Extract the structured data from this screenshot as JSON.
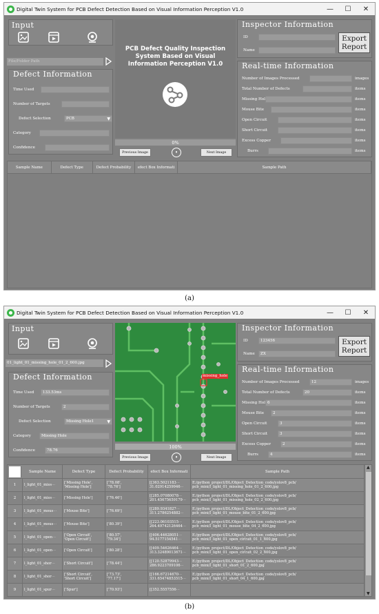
{
  "captions": [
    "(a)",
    "(b)"
  ],
  "colors": {
    "window_bg": "#808080",
    "panel_bg": "#878787",
    "field_bg": "#9a9a9a",
    "pcb_green": "#2e8b3e",
    "app_icon": "#3bb54a"
  },
  "window_a": {
    "title": "Digital Twin System for PCB Defect Detection Based on Visual Information Perception V1.0",
    "controls": {
      "min": "—",
      "max": "☐",
      "close": "✕"
    },
    "input": {
      "title": "Input",
      "icons": [
        "image-icon",
        "video-icon",
        "camera-icon"
      ],
      "path_placeholder": "File/Folder Path"
    },
    "defect_info": {
      "title": "Defect Information",
      "time_used_label": "Time Used",
      "time_used_value": "",
      "targets_label": "Number of Targets",
      "targets_value": "",
      "selection_label": "Defect Selection",
      "selection_value": "PCB",
      "category_label": "Category",
      "category_value": "",
      "confidence_label": "Confidence",
      "confidence_value": ""
    },
    "center": {
      "title_line1": "PCB Defect Quality Inspection",
      "title_line2": "System Based on Visual",
      "title_line3": "Information Perception V1.0",
      "progress_text": "0%",
      "progress": 0.0
    },
    "buttons": {
      "prev": "Previous Image",
      "pause": "⏸",
      "next": "Next Image"
    },
    "inspector": {
      "title": "Inspector Information",
      "id_label": "ID",
      "id_value": "",
      "name_label": "Name",
      "name_value": "",
      "export_l1": "Export",
      "export_l2": "Report"
    },
    "realtime": {
      "title": "Real-time Information",
      "rows": [
        {
          "label": "Number of Images Processed",
          "value": "",
          "unit": "images"
        },
        {
          "label": "Total Number of Defects",
          "value": "",
          "unit": "items"
        },
        {
          "label": "Missing Hole",
          "value": "",
          "unit": "items"
        },
        {
          "label": "Mouse Bite",
          "value": "",
          "unit": "items"
        },
        {
          "label": "Open Circuit",
          "value": "",
          "unit": "items"
        },
        {
          "label": "Short Circuit",
          "value": "",
          "unit": "items"
        },
        {
          "label": "Excess Copper",
          "value": "",
          "unit": "items"
        },
        {
          "label": "Burrs",
          "value": "",
          "unit": "items"
        }
      ]
    },
    "table": {
      "headers": [
        "Sample Name",
        "Defect Type",
        "Defect Probability",
        "efect Box Informati",
        "Sample Path"
      ]
    }
  },
  "window_b": {
    "title": "Digital Twin System for PCB Defect Detection Based on Visual Information Perception V1.0",
    "controls": {
      "min": "—",
      "max": "☐",
      "close": "✕"
    },
    "input": {
      "title": "Input",
      "icons": [
        "image-icon",
        "video-icon",
        "camera-icon"
      ],
      "path_value": "01_light_01_missing_hole_01_2_600.jpg"
    },
    "defect_info": {
      "title": "Defect Information",
      "time_used_label": "Time Used",
      "time_used_value": "133.53ms",
      "targets_label": "Number of Targets",
      "targets_value": "2",
      "selection_label": "Defect Selection",
      "selection_value": "Missing Hole1",
      "category_label": "Category",
      "category_value": "Missing Hole",
      "confidence_label": "Confidence",
      "confidence_value": "78.76"
    },
    "center": {
      "detection_label": "missing_hole",
      "progress_text": "100%",
      "progress": 1.0
    },
    "buttons": {
      "prev": "Previous Image",
      "pause": "⏸",
      "next": "Next Image"
    },
    "inspector": {
      "title": "Inspector Information",
      "id_label": "ID",
      "id_value": "123456",
      "name_label": "Name",
      "name_value": "ZX",
      "export_l1": "Export",
      "export_l2": "Report"
    },
    "realtime": {
      "title": "Real-time Information",
      "rows": [
        {
          "label": "Number of Images Processed",
          "value": "12",
          "unit": "images"
        },
        {
          "label": "Total Number of Defects",
          "value": "20",
          "unit": "items"
        },
        {
          "label": "Missing Hole",
          "value": "6",
          "unit": "items"
        },
        {
          "label": "Mouse Bite",
          "value": "2",
          "unit": "items"
        },
        {
          "label": "Open Circuit",
          "value": "3",
          "unit": "items"
        },
        {
          "label": "Short Circuit",
          "value": "3",
          "unit": "items"
        },
        {
          "label": "Excess Copper",
          "value": "2",
          "unit": "items"
        },
        {
          "label": "Burrs",
          "value": "4",
          "unit": "items"
        }
      ]
    },
    "table": {
      "headers": [
        "",
        "Sample Name",
        "Defect Type",
        "Defect Probability",
        "efect Box Informati",
        "Sample Path"
      ],
      "rows": [
        {
          "n": "1",
          "name": "l_light_01_miss⋯",
          "type": "['Missing Hole',\n'Missing Hole']",
          "prob": "['78.08',\n'78.76']",
          "box": "[[363.5021183⋯\n31.02914259946⋯",
          "path": "E:/python_project/DL/Object_Detection_code/yolov8_pcb/\npcb_mini/l_light_01_missing_hole_01_2_600.jpg"
        },
        {
          "n": "2",
          "name": "l_light_01_miss⋯",
          "type": "['Missing Hole']",
          "prob": "['76.46']",
          "box": "[[285.07080078⋯\n201.45675659179⋯",
          "path": "E:/python_project/DL/Object_Detection_code/yolov8_pcb/\npcb_mini/l_light_01_missing_hole_02_2_600.jpg"
        },
        {
          "n": "3",
          "name": "l_light_01_mous⋯",
          "type": "['Mouse Bite']",
          "prob": "['76.69']",
          "box": "[[289.9341827⋯\n311.2786254882⋯",
          "path": "E:/python_project/DL/Object_Detection_code/yolov8_pcb/\npcb_mini/l_light_01_mouse_bite_01_2_600.jpg"
        },
        {
          "n": "4",
          "name": "l_light_01_mous⋯",
          "type": "['Mouse Bite']",
          "prob": "['80.39']",
          "box": "[[223.06103515⋯\n264.49742126464⋯",
          "path": "E:/python_project/DL/Object_Detection_code/yolov8_pcb/\npcb_mini/l_light_01_mouse_bite_04_2_600.jpg"
        },
        {
          "n": "5",
          "name": "l_light_01_open⋯",
          "type": "['Open Circuit',\n'Open Circuit']",
          "prob": "['80.57',\n'79.34']",
          "box": "[[406.44628051⋯\n94.5177154541⋯",
          "path": "E:/python_project/DL/Object_Detection_code/yolov8_pcb/\npcb_mini/l_light_01_open_circuit_01_1_600.jpg"
        },
        {
          "n": "6",
          "name": "l_light_01_open⋯",
          "type": "['Open Circuit']",
          "prob": "['80.28']",
          "box": "[[409.54626464⋯\n313.32489013671⋯",
          "path": "E:/python_project/DL/Object_Detection_code/yolov8_pcb/\npcb_mini/l_light_01_open_circuit_02_2_600.jpg"
        },
        {
          "n": "7",
          "name": "l_light_01_shor⋯",
          "type": "['Short Circuit']",
          "prob": "['78.44']",
          "box": "[[120.52879943⋯\n286.9223709106⋯",
          "path": "E:/python_project/DL/Object_Detection_code/yolov8_pcb/\npcb_mini/l_light_01_short_01_2_600.jpg"
        },
        {
          "n": "8",
          "name": "l_light_01_shor⋯",
          "type": "['Short Circuit',\n'Short Circuit']",
          "prob": "['73.73',\n'77.17']",
          "box": "[[166.67214670⋯\n331.65474853515⋯",
          "path": "E:/python_project/DL/Object_Detection_code/yolov8_pcb/\npcb_mini/l_light_01_short_04_1_600.jpg"
        },
        {
          "n": "9",
          "name": "l_light_01_spur⋯",
          "type": "['Spur']",
          "prob": "['70.93']",
          "box": "[[352.5557556⋯",
          "path": ""
        }
      ]
    }
  }
}
